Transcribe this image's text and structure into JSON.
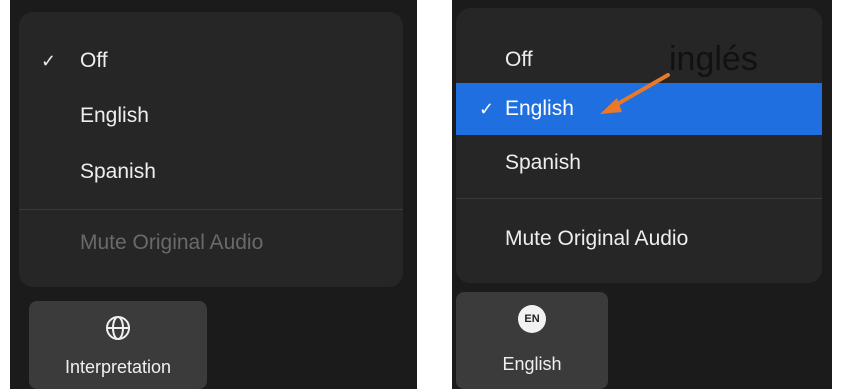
{
  "left_panel": {
    "menu_items": [
      {
        "label": "Off",
        "checked": true,
        "disabled": false
      },
      {
        "label": "English",
        "checked": false,
        "disabled": false
      },
      {
        "label": "Spanish",
        "checked": false,
        "disabled": false
      }
    ],
    "mute_item": {
      "label": "Mute Original Audio",
      "disabled": true
    },
    "toolbar_button": {
      "label": "Interpretation",
      "icon": "globe-icon"
    }
  },
  "right_panel": {
    "menu_items": [
      {
        "label": "Off",
        "checked": false,
        "selected": false
      },
      {
        "label": "English",
        "checked": true,
        "selected": true
      },
      {
        "label": "Spanish",
        "checked": false,
        "selected": false
      }
    ],
    "mute_item": {
      "label": "Mute Original Audio",
      "disabled": false
    },
    "toolbar_button": {
      "label": "English",
      "badge": "EN",
      "icon": "en-badge-icon"
    }
  },
  "annotation": {
    "text": "inglés",
    "arrow_color": "#e8792b"
  },
  "check_glyph": "✓",
  "colors": {
    "selected": "#1f6fe0",
    "menu_bg": "#262626",
    "panel_bg": "#1b1b1b",
    "toolbar_bg": "#3b3b3b"
  }
}
